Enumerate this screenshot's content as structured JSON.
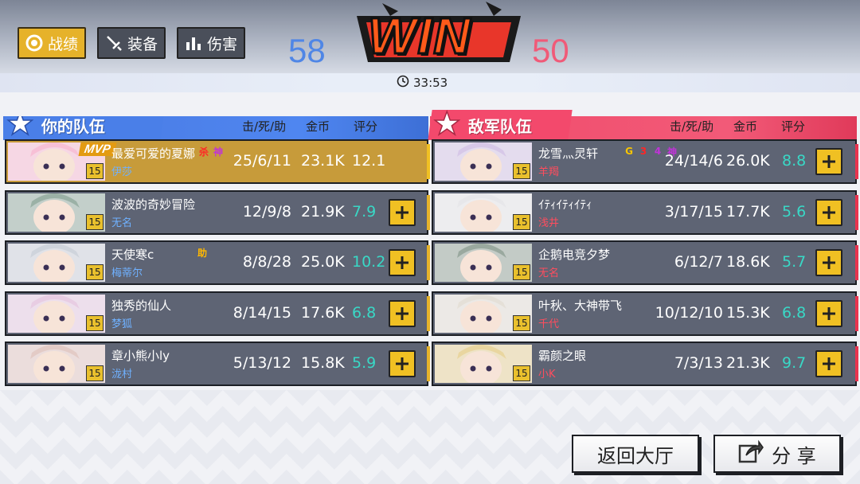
{
  "tabs": [
    {
      "label": "战绩",
      "icon": "target-icon",
      "active": true
    },
    {
      "label": "装备",
      "icon": "sword-icon",
      "active": false
    },
    {
      "label": "伤害",
      "icon": "bar-chart-icon",
      "active": false
    }
  ],
  "result": {
    "title": "WIN",
    "blue_score": "58",
    "red_score": "50",
    "duration": "33:53"
  },
  "columns": {
    "kda": "击/死/助",
    "gold": "金币",
    "rating": "评分"
  },
  "teams": {
    "ally": {
      "label": "你的队伍",
      "color": "#4f86f0",
      "players": [
        {
          "name": "最爱可爱的夏娜",
          "hero": "伊莎",
          "level": "15",
          "kda": "25/6/11",
          "gold": "23.1K",
          "rating": "12.1",
          "badge": "MVP",
          "tags": [
            "杀",
            "神"
          ]
        },
        {
          "name": "波波的奇妙冒险",
          "hero": "无名",
          "level": "15",
          "kda": "12/9/8",
          "gold": "21.9K",
          "rating": "7.9",
          "tags": []
        },
        {
          "name": "天使寒c",
          "hero": "梅蒂尔",
          "level": "15",
          "kda": "8/8/28",
          "gold": "25.0K",
          "rating": "10.2",
          "tags": [
            "助"
          ]
        },
        {
          "name": "独秀的仙人",
          "hero": "梦狐",
          "level": "15",
          "kda": "8/14/15",
          "gold": "17.6K",
          "rating": "6.8",
          "tags": []
        },
        {
          "name": "章小熊小ly",
          "hero": "泷村",
          "level": "15",
          "kda": "5/13/12",
          "gold": "15.8K",
          "rating": "5.9",
          "tags": []
        }
      ]
    },
    "enemy": {
      "label": "敌军队伍",
      "color": "#f25a78",
      "players": [
        {
          "name": "龙雪灬灵轩",
          "hero": "羊羯",
          "level": "15",
          "kda": "24/14/6",
          "gold": "26.0K",
          "rating": "8.8",
          "tags": [
            "G",
            "3",
            "4",
            "神"
          ]
        },
        {
          "name": "ｲﾃｨｲﾃｨｲﾃｨ",
          "hero": "浅井",
          "level": "15",
          "kda": "3/17/15",
          "gold": "17.7K",
          "rating": "5.6",
          "tags": []
        },
        {
          "name": "企鹅电竞夕梦",
          "hero": "无名",
          "level": "15",
          "kda": "6/12/7",
          "gold": "18.6K",
          "rating": "5.7",
          "tags": []
        },
        {
          "name": "叶秋、大神带飞",
          "hero": "千代",
          "level": "15",
          "kda": "10/12/10",
          "gold": "15.3K",
          "rating": "6.8",
          "tags": []
        },
        {
          "name": "霸颜之眼",
          "hero": "小K",
          "level": "15",
          "kda": "7/3/13",
          "gold": "21.3K",
          "rating": "9.7",
          "tags": []
        }
      ]
    }
  },
  "buttons": {
    "lobby": "返回大厅",
    "share": "分 享"
  }
}
